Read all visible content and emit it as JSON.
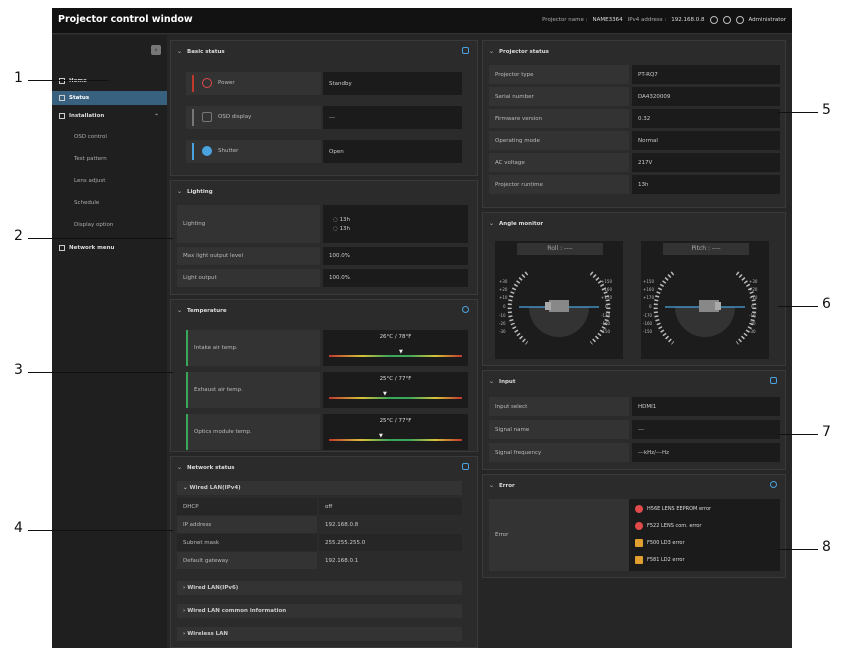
{
  "titlebar": {
    "title": "Projector control window",
    "projector_name_label": "Projector name :",
    "projector_name": "NAME3364",
    "ipv4_label": "IPv4 address :",
    "ipv4": "192.168.0.8",
    "user": "Administrator"
  },
  "sidebar": {
    "collapse": "‹",
    "items": [
      {
        "label": "Home"
      },
      {
        "label": "Status"
      },
      {
        "label": "Installation"
      },
      {
        "label": "OSD control"
      },
      {
        "label": "Test pattern"
      },
      {
        "label": "Lens adjust"
      },
      {
        "label": "Schedule"
      },
      {
        "label": "Display option"
      },
      {
        "label": "Network menu"
      }
    ]
  },
  "basic": {
    "title": "Basic status",
    "items": [
      {
        "label": "Power",
        "value": "Standby"
      },
      {
        "label": "OSD display",
        "value": "---"
      },
      {
        "label": "Shutter",
        "value": "Open"
      }
    ]
  },
  "lighting": {
    "title": "Lighting",
    "rows": [
      {
        "label": "Lighting",
        "value1": "13h",
        "value2": "13h"
      },
      {
        "label": "Max light output level",
        "value": "100.0%"
      },
      {
        "label": "Light output",
        "value": "100.0%"
      }
    ]
  },
  "temperature": {
    "title": "Temperature",
    "rows": [
      {
        "label": "Intake air temp.",
        "value": "26°C / 78°F"
      },
      {
        "label": "Exhaust air temp.",
        "value": "25°C / 77°F"
      },
      {
        "label": "Optics module temp.",
        "value": "25°C / 77°F"
      }
    ]
  },
  "network": {
    "title": "Network status",
    "section1": "Wired LAN(IPv4)",
    "rows": [
      {
        "label": "DHCP",
        "value": "off"
      },
      {
        "label": "IP address",
        "value": "192.168.0.8"
      },
      {
        "label": "Subnet mask",
        "value": "255.255.255.0"
      },
      {
        "label": "Default gateway",
        "value": "192.168.0.1"
      }
    ],
    "collapsed": [
      "Wired LAN(IPv6)",
      "Wired LAN common information",
      "Wireless LAN"
    ]
  },
  "projector": {
    "title": "Projector status",
    "rows": [
      {
        "label": "Projector type",
        "value": "PT-RQ7"
      },
      {
        "label": "Serial number",
        "value": "DA4320009"
      },
      {
        "label": "Firmware version",
        "value": "0.32"
      },
      {
        "label": "Operating mode",
        "value": "Normal"
      },
      {
        "label": "AC voltage",
        "value": "217V"
      },
      {
        "label": "Projector runtime",
        "value": "13h"
      }
    ]
  },
  "angle": {
    "title": "Angle monitor",
    "roll": "Roll : ----",
    "pitch": "Pitch : ----",
    "roll_left": [
      "+30",
      "+20",
      "+10",
      "0",
      "-10",
      "-20",
      "-30"
    ],
    "roll_right": [
      "+150",
      "+160",
      "+170",
      "0",
      "-170",
      "-160",
      "-150"
    ],
    "pitch_left": [
      "+150",
      "+160",
      "+170",
      "0",
      "-170",
      "-160",
      "-150"
    ],
    "pitch_right": [
      "+30",
      "+20",
      "+10",
      "0",
      "-10",
      "-20",
      "-30"
    ]
  },
  "input": {
    "title": "Input",
    "rows": [
      {
        "label": "Input select",
        "value": "HDMI1"
      },
      {
        "label": "Signal name",
        "value": "---"
      },
      {
        "label": "Signal frequency",
        "value": "---kHz/---Hz"
      }
    ]
  },
  "error": {
    "title": "Error",
    "label": "Error",
    "items": [
      {
        "text": "H56E LENS EEPROM error",
        "color": "#e04a4a"
      },
      {
        "text": "F522 LENS com. error",
        "color": "#e04a4a"
      },
      {
        "text": "F500 LD3 error",
        "color": "#e0a030"
      },
      {
        "text": "F581 LD2 error",
        "color": "#e0a030"
      }
    ]
  },
  "callouts": [
    "1",
    "2",
    "3",
    "4",
    "5",
    "6",
    "7",
    "8"
  ]
}
